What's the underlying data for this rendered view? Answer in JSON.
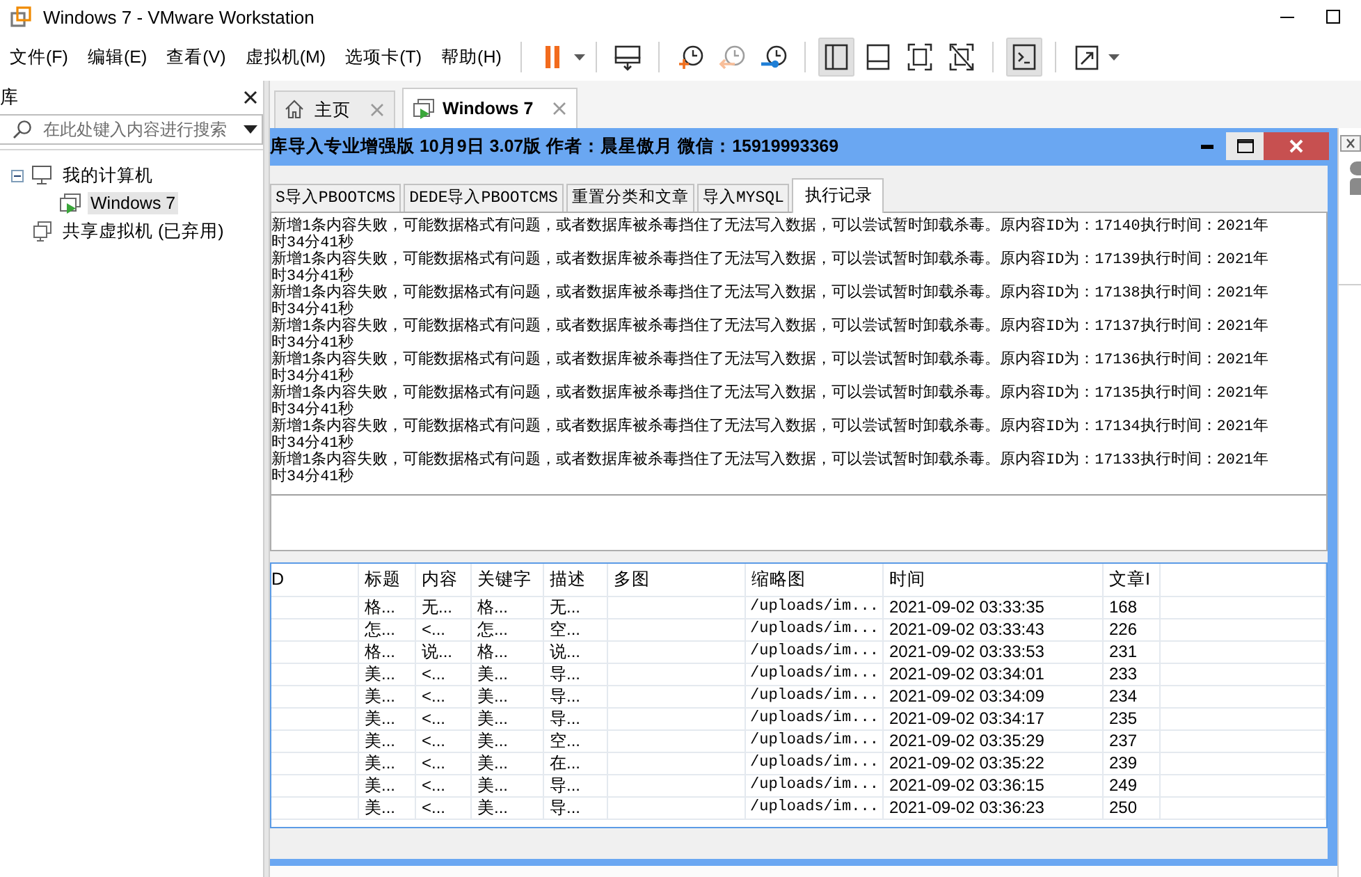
{
  "window": {
    "title": "Windows 7 - VMware Workstation"
  },
  "menu": [
    "文件(F)",
    "编辑(E)",
    "查看(V)",
    "虚拟机(M)",
    "选项卡(T)",
    "帮助(H)"
  ],
  "toolbar": {
    "groups": [
      [
        {
          "kind": "pause",
          "selected": false,
          "disabled": false,
          "dropdown": true
        }
      ],
      [
        {
          "kind": "send-keys",
          "selected": false,
          "disabled": false,
          "dropdown": false
        }
      ],
      [
        {
          "kind": "snapshot",
          "selected": false,
          "disabled": false,
          "dropdown": false
        },
        {
          "kind": "revert",
          "selected": false,
          "disabled": true,
          "dropdown": false
        },
        {
          "kind": "snapshot-manager",
          "selected": false,
          "disabled": false,
          "dropdown": false
        }
      ],
      [
        {
          "kind": "library-view",
          "selected": true,
          "disabled": false,
          "dropdown": false
        },
        {
          "kind": "thumbnail-view",
          "selected": false,
          "disabled": false,
          "dropdown": false
        },
        {
          "kind": "full-screen",
          "selected": false,
          "disabled": false,
          "dropdown": false
        },
        {
          "kind": "unity",
          "selected": false,
          "disabled": false,
          "dropdown": false
        }
      ],
      [
        {
          "kind": "console",
          "selected": true,
          "disabled": false,
          "dropdown": false
        }
      ],
      [
        {
          "kind": "stretch",
          "selected": false,
          "disabled": false,
          "dropdown": true
        }
      ]
    ]
  },
  "library": {
    "title": "库",
    "search": {
      "placeholder": "在此处键入内容进行搜索"
    },
    "tree": [
      {
        "label": "我的计算机",
        "kind": "computer",
        "expanded": true,
        "selected": false,
        "children": [
          {
            "label": "Windows 7",
            "kind": "vm",
            "selected": true
          }
        ]
      },
      {
        "label": "共享虚拟机 (已弃用)",
        "kind": "shared",
        "selected": false
      }
    ]
  },
  "tabs": [
    {
      "label": "主页",
      "kind": "home",
      "selected": false
    },
    {
      "label": "Windows 7",
      "kind": "vm",
      "selected": true
    }
  ],
  "guest": {
    "title": "库导入专业增强版 10月9日 3.07版 作者：晨星傲月 微信：15919993369",
    "tabs": [
      {
        "label": "S导入PBOOTCMS",
        "selected": false
      },
      {
        "label": "DEDE导入PBOOTCMS",
        "selected": false
      },
      {
        "label": "重置分类和文章",
        "selected": false
      },
      {
        "label": "导入MYSQL",
        "selected": false
      },
      {
        "label": "执行记录",
        "selected": true
      }
    ],
    "log": [
      {
        "text": "新增1条内容失败，可能数据格式有问题，或者数据库被杀毒挡住了无法写入数据，可以尝试暂时卸载杀毒。原内容ID为：17140执行时间：2021年",
        "wrap": "时34分41秒"
      },
      {
        "text": "新增1条内容失败，可能数据格式有问题，或者数据库被杀毒挡住了无法写入数据，可以尝试暂时卸载杀毒。原内容ID为：17139执行时间：2021年",
        "wrap": "时34分41秒"
      },
      {
        "text": "新增1条内容失败，可能数据格式有问题，或者数据库被杀毒挡住了无法写入数据，可以尝试暂时卸载杀毒。原内容ID为：17138执行时间：2021年",
        "wrap": "时34分41秒"
      },
      {
        "text": "新增1条内容失败，可能数据格式有问题，或者数据库被杀毒挡住了无法写入数据，可以尝试暂时卸载杀毒。原内容ID为：17137执行时间：2021年",
        "wrap": "时34分41秒"
      },
      {
        "text": "新增1条内容失败，可能数据格式有问题，或者数据库被杀毒挡住了无法写入数据，可以尝试暂时卸载杀毒。原内容ID为：17136执行时间：2021年",
        "wrap": "时34分41秒"
      },
      {
        "text": "新增1条内容失败，可能数据格式有问题，或者数据库被杀毒挡住了无法写入数据，可以尝试暂时卸载杀毒。原内容ID为：17135执行时间：2021年",
        "wrap": "时34分41秒"
      },
      {
        "text": "新增1条内容失败，可能数据格式有问题，或者数据库被杀毒挡住了无法写入数据，可以尝试暂时卸载杀毒。原内容ID为：17134执行时间：2021年",
        "wrap": "时34分41秒"
      },
      {
        "text": "新增1条内容失败，可能数据格式有问题，或者数据库被杀毒挡住了无法写入数据，可以尝试暂时卸载杀毒。原内容ID为：17133执行时间：2021年",
        "wrap": "时34分41秒"
      }
    ],
    "table": {
      "columns": [
        "D",
        "标题",
        "内容",
        "关键字",
        "描述",
        "多图",
        "缩略图",
        "时间",
        "文章I"
      ],
      "rows": [
        {
          "title": "格...",
          "content": "无...",
          "keywords": "格...",
          "description": "无...",
          "thumbnail": "/uploads/im...",
          "time": "2021-09-02 03:33:35",
          "article_id": "168"
        },
        {
          "title": "怎...",
          "content": "<...",
          "keywords": "怎...",
          "description": "空...",
          "thumbnail": "/uploads/im...",
          "time": "2021-09-02 03:33:43",
          "article_id": "226"
        },
        {
          "title": "格...",
          "content": "说...",
          "keywords": "格...",
          "description": "说...",
          "thumbnail": "/uploads/im...",
          "time": "2021-09-02 03:33:53",
          "article_id": "231"
        },
        {
          "title": "美...",
          "content": "<...",
          "keywords": "美...",
          "description": "导...",
          "thumbnail": "/uploads/im...",
          "time": "2021-09-02 03:34:01",
          "article_id": "233"
        },
        {
          "title": "美...",
          "content": "<...",
          "keywords": "美...",
          "description": "导...",
          "thumbnail": "/uploads/im...",
          "time": "2021-09-02 03:34:09",
          "article_id": "234"
        },
        {
          "title": "美...",
          "content": "<...",
          "keywords": "美...",
          "description": "导...",
          "thumbnail": "/uploads/im...",
          "time": "2021-09-02 03:34:17",
          "article_id": "235"
        },
        {
          "title": "美...",
          "content": "<...",
          "keywords": "美...",
          "description": "空...",
          "thumbnail": "/uploads/im...",
          "time": "2021-09-02 03:35:29",
          "article_id": "237"
        },
        {
          "title": "美...",
          "content": "<...",
          "keywords": "美...",
          "description": "在...",
          "thumbnail": "/uploads/im...",
          "time": "2021-09-02 03:35:22",
          "article_id": "239"
        },
        {
          "title": "美...",
          "content": "<...",
          "keywords": "美...",
          "description": "导...",
          "thumbnail": "/uploads/im...",
          "time": "2021-09-02 03:36:15",
          "article_id": "249"
        },
        {
          "title": "美...",
          "content": "<...",
          "keywords": "美...",
          "description": "导...",
          "thumbnail": "/uploads/im...",
          "time": "2021-09-02 03:36:23",
          "article_id": "250"
        }
      ]
    }
  }
}
